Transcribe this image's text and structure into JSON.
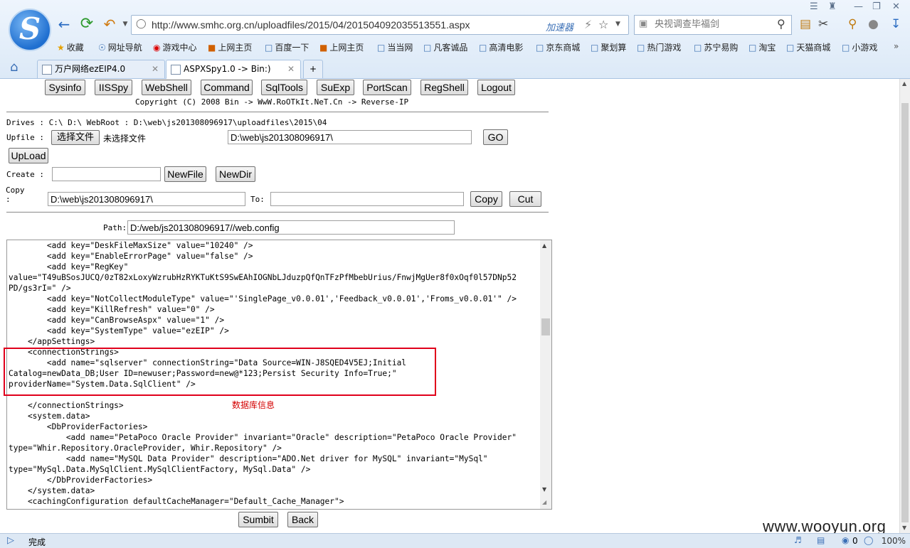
{
  "browser": {
    "url": "http://www.smhc.org.cn/uploadfiles/2015/04/201504092035513551.aspx",
    "accelerator": "加速器",
    "search_placeholder": "央视调查毕福剑",
    "bookmarks": [
      "收藏",
      "网址导航",
      "游戏中心",
      "上网主页",
      "百度一下",
      "上网主页",
      "当当网",
      "凡客诚品",
      "高清电影",
      "京东商城",
      "聚划算",
      "热门游戏",
      "苏宁易购",
      "淘宝",
      "天猫商城",
      "小游戏"
    ],
    "tabs": [
      "万户网络ezEIP4.0",
      "ASPXSpy1.0 -> Bin:)"
    ],
    "status": "完成",
    "zoom": "100%",
    "status_count": "0"
  },
  "toolbar": {
    "buttons": [
      "Sysinfo",
      "IISSpy",
      "WebShell",
      "Command",
      "SqlTools",
      "SuExp",
      "PortScan",
      "RegShell",
      "Logout"
    ],
    "copyright": "Copyright (C) 2008 Bin -> WwW.RoOTkIt.NeT.Cn -> Reverse-IP"
  },
  "panel": {
    "drives_line": "Drives : C:\\ D:\\  WebRoot : D:\\web\\js201308096917\\uploadfiles\\2015\\04",
    "upfile_label": "Upfile :",
    "choose_file": "选择文件",
    "no_file": "未选择文件",
    "go_path": "D:\\web\\js201308096917\\",
    "go": "GO",
    "upload": "UpLoad",
    "create_label": "Create :",
    "create_value": "",
    "newfile": "NewFile",
    "newdir": "NewDir",
    "copy_label": "Copy",
    "copy_colon": ":",
    "copy_from": "D:\\web\\js201308096917\\",
    "to_label": "To:",
    "copy_to": "",
    "copy_btn": "Copy",
    "cut_btn": "Cut"
  },
  "editor": {
    "path_label": "Path:",
    "path": "D:/web/js201308096917//web.config",
    "code": "        <add key=\"DeskFileMaxSize\" value=\"10240\" />\n        <add key=\"EnableErrorPage\" value=\"false\" />\n        <add key=\"RegKey\"\nvalue=\"T49uBSosJUCQ/0zT82xLoxyWzrubHzRYKTuKtS9SwEAhIOGNbLJduzpQfQnTFzPfMbebUrius/FnwjMgUer8f0xOqf0l57DNp52\nPD/gs3rI=\" />\n        <add key=\"NotCollectModuleType\" value=\"'SinglePage_v0.0.01','Feedback_v0.0.01','Froms_v0.0.01'\" />\n        <add key=\"KillRefresh\" value=\"0\" />\n        <add key=\"CanBrowseAspx\" value=\"1\" />\n        <add key=\"SystemType\" value=\"ezEIP\" />\n    </appSettings>\n    <connectionStrings>\n        <add name=\"sqlserver\" connectionString=\"Data Source=WIN-J8SQED4V5EJ;Initial\nCatalog=newData_DB;User ID=newuser;Password=new@*123;Persist Security Info=True;\"\nproviderName=\"System.Data.SqlClient\" />\n\n    </connectionStrings>\n    <system.data>\n        <DbProviderFactories>\n            <add name=\"PetaPoco Oracle Provider\" invariant=\"Oracle\" description=\"PetaPoco Oracle Provider\"\ntype=\"Whir.Repository.OracleProvider, Whir.Repository\" />\n            <add name=\"MySQL Data Provider\" description=\"ADO.Net driver for MySQL\" invariant=\"MySql\"\ntype=\"MySql.Data.MySqlClient.MySqlClientFactory, MySql.Data\" />\n        </DbProviderFactories>\n    </system.data>\n    <cachingConfiguration defaultCacheManager=\"Default_Cache_Manager\">",
    "annotation": "数据库信息",
    "submit": "Sumbit",
    "back": "Back"
  },
  "watermark": "www.wooyun.org",
  "colors": {
    "highlight": "#e0001b",
    "annotation": "#d40000",
    "chrome": "#dce9f7"
  }
}
